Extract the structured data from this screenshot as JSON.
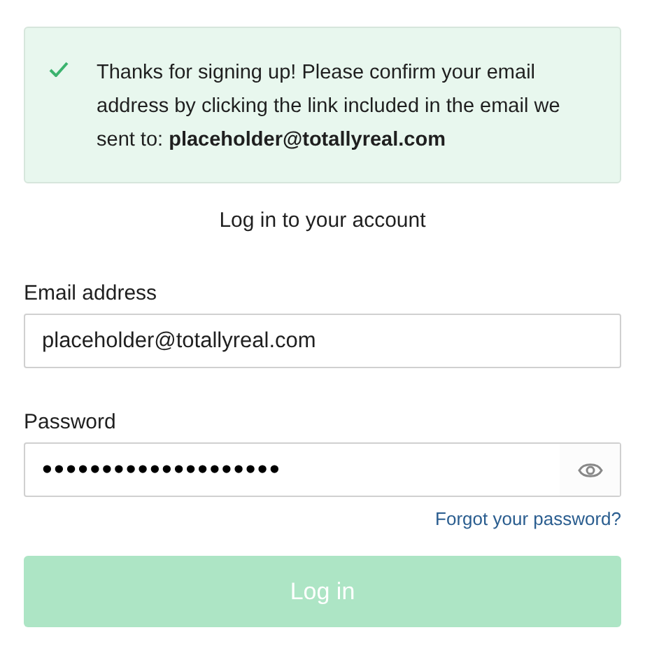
{
  "alert": {
    "kind": "success",
    "message": "Thanks for signing up! Please confirm your email address by clicking the link included in the email we sent to: **placeholder@totallyreal.com**"
  },
  "heading": "Log in to your account",
  "email": {
    "label": "Email address",
    "value": "placeholder@totallyreal.com"
  },
  "password": {
    "label": "Password",
    "value": "••••••••••••••••••••"
  },
  "forgot_link": "Forgot your password?",
  "login_button": {
    "label": "Log in",
    "disabled": true
  }
}
